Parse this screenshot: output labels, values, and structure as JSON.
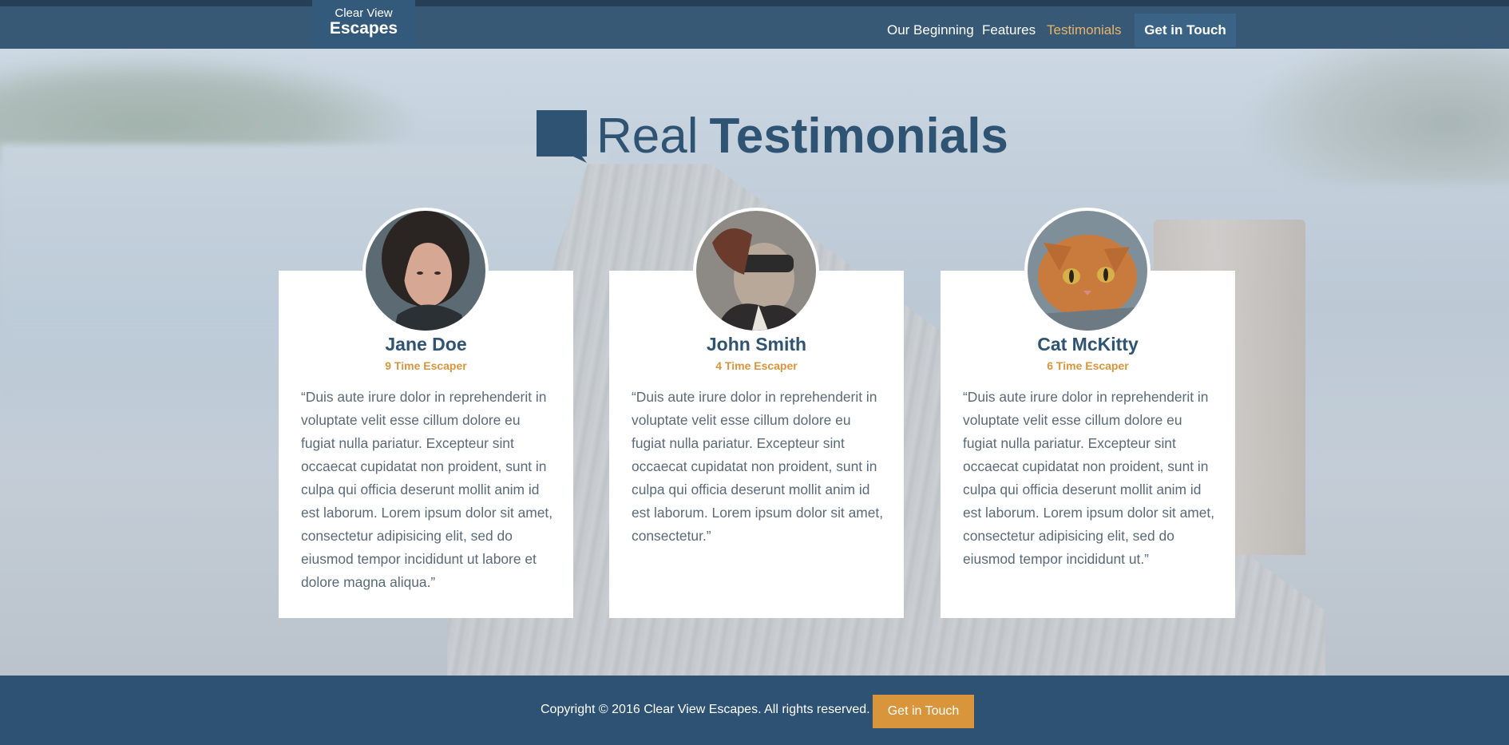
{
  "brand": {
    "line1": "Clear View",
    "line2": "Escapes"
  },
  "nav": {
    "items": [
      {
        "label": "Our Beginning",
        "active": false
      },
      {
        "label": "Features",
        "active": false
      },
      {
        "label": "Testimonials",
        "active": true
      }
    ],
    "cta_label": "Get in Touch"
  },
  "section": {
    "title_light": "Real",
    "title_bold": "Testimonials",
    "icon": "speech-bubble-icon"
  },
  "testimonials": [
    {
      "name": "Jane Doe",
      "subtitle": "9 Time Escaper",
      "avatar": "woman-portrait",
      "quote": "“Duis aute irure dolor in reprehenderit in voluptate velit esse cillum dolore eu fugiat nulla pariatur. Excepteur sint occaecat cupidatat non proident, sunt in culpa qui officia deserunt mollit anim id est laborum. Lorem ipsum dolor sit amet, consectetur adipisicing elit, sed do eiusmod tempor incididunt ut labore et dolore magna aliqua.”"
    },
    {
      "name": "John Smith",
      "subtitle": "4 Time Escaper",
      "avatar": "man-with-vr-headset",
      "quote": "“Duis aute irure dolor in reprehenderit in voluptate velit esse cillum dolore eu fugiat nulla pariatur. Excepteur sint occaecat cupidatat non proident, sunt in culpa qui officia deserunt mollit anim id est laborum. Lorem ipsum dolor sit amet, consectetur.”"
    },
    {
      "name": "Cat McKitty",
      "subtitle": "6 Time Escaper",
      "avatar": "orange-cat",
      "quote": "“Duis aute irure dolor in reprehenderit in voluptate velit esse cillum dolore eu fugiat nulla pariatur. Excepteur sint occaecat cupidatat non proident, sunt in culpa qui officia deserunt mollit anim id est laborum. Lorem ipsum dolor sit amet, consectetur adipisicing elit, sed do eiusmod tempor incididunt ut.”"
    }
  ],
  "footer": {
    "copyright": "Copyright © 2016 Clear View Escapes. All rights reserved.",
    "cta_label": "Get in Touch"
  },
  "colors": {
    "primary": "#2f5373",
    "accent": "#d9953c",
    "nav_active": "#e8b46a",
    "card": "#ffffff"
  }
}
